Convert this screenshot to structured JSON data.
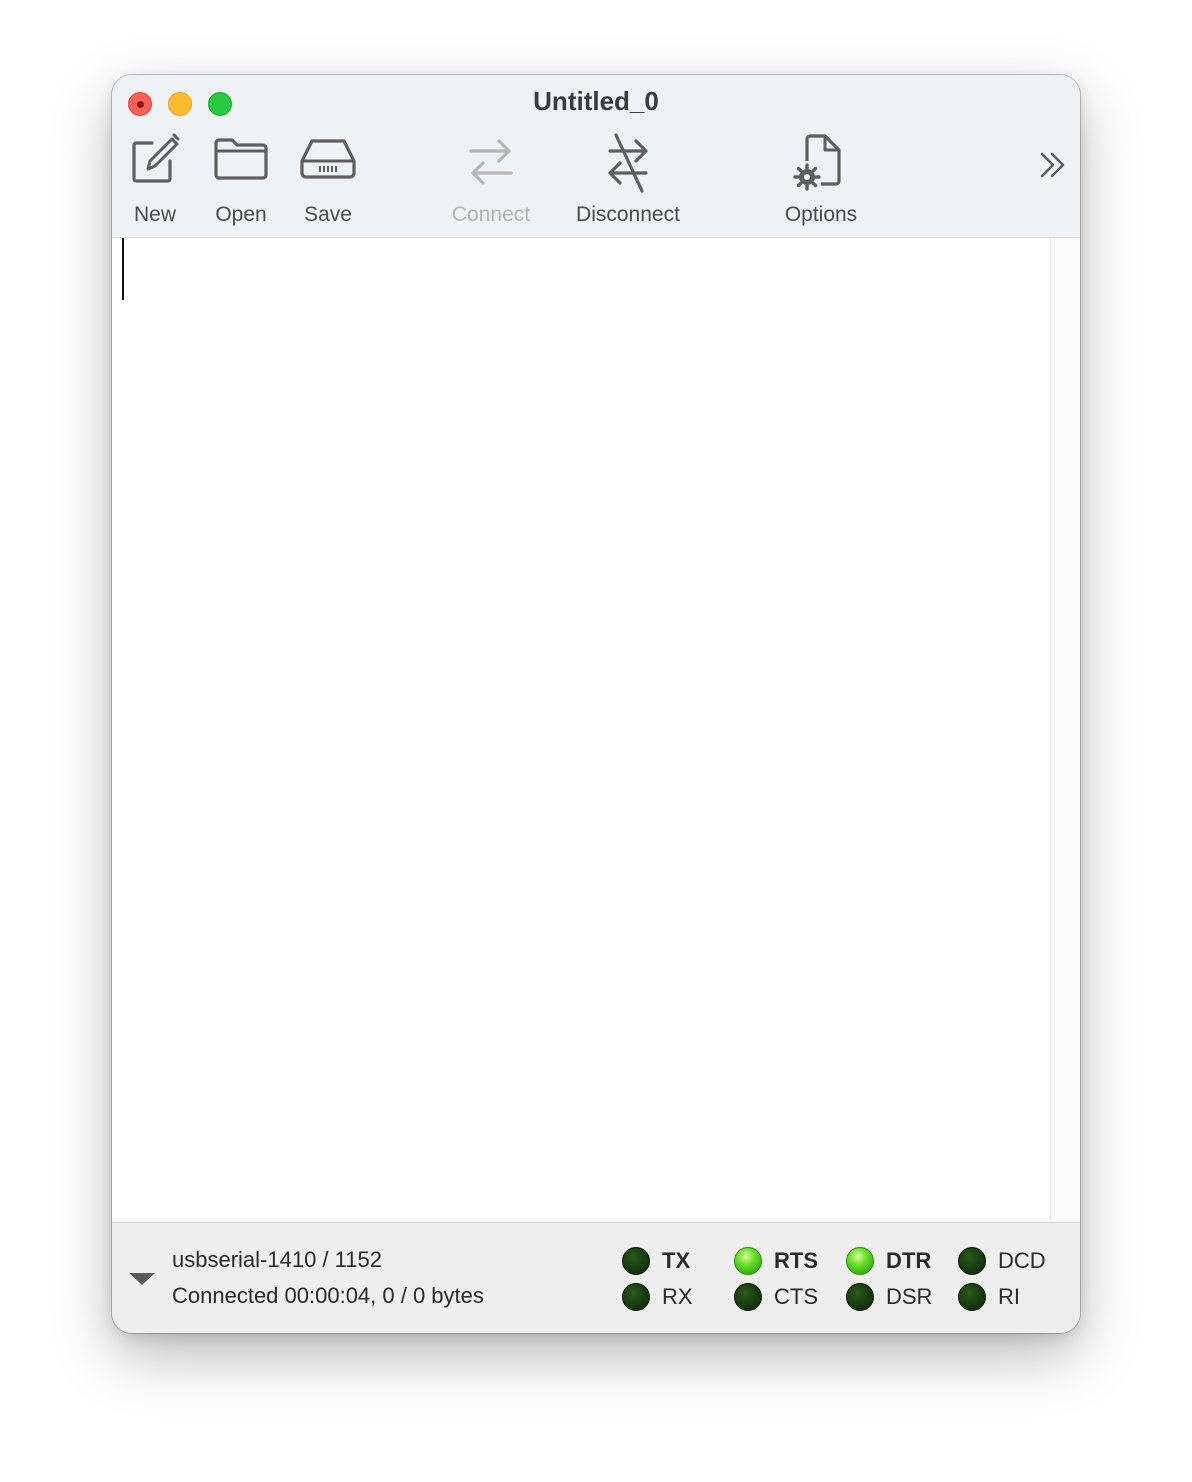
{
  "window": {
    "title": "Untitled_0"
  },
  "toolbar": {
    "items": [
      {
        "id": "new",
        "label": "New",
        "icon": "compose-icon",
        "enabled": true
      },
      {
        "id": "open",
        "label": "Open",
        "icon": "folder-icon",
        "enabled": true
      },
      {
        "id": "save",
        "label": "Save",
        "icon": "drive-icon",
        "enabled": true
      },
      {
        "id": "connect",
        "label": "Connect",
        "icon": "arrows-swap-icon",
        "enabled": false
      },
      {
        "id": "disconnect",
        "label": "Disconnect",
        "icon": "arrows-disconnect-icon",
        "enabled": true
      },
      {
        "id": "options",
        "label": "Options",
        "icon": "document-gear-icon",
        "enabled": true
      }
    ],
    "overflow_icon": "chevron-double-right-icon"
  },
  "editor": {
    "content": ""
  },
  "status": {
    "port": "usbserial-1410 / 1152",
    "connection": "Connected 00:00:04, 0 / 0 bytes"
  },
  "signals": {
    "tx": {
      "label": "TX",
      "active": false
    },
    "rx": {
      "label": "RX",
      "active": false
    },
    "rts": {
      "label": "RTS",
      "active": true
    },
    "cts": {
      "label": "CTS",
      "active": false
    },
    "dtr": {
      "label": "DTR",
      "active": true
    },
    "dsr": {
      "label": "DSR",
      "active": false
    },
    "dcd": {
      "label": "DCD",
      "active": false
    },
    "ri": {
      "label": "RI",
      "active": false
    }
  },
  "colors": {
    "led_on": "#5fd42a",
    "led_off": "#173a0f",
    "close": "#fe5f57",
    "minimize": "#febc2e",
    "zoom": "#28c840"
  }
}
